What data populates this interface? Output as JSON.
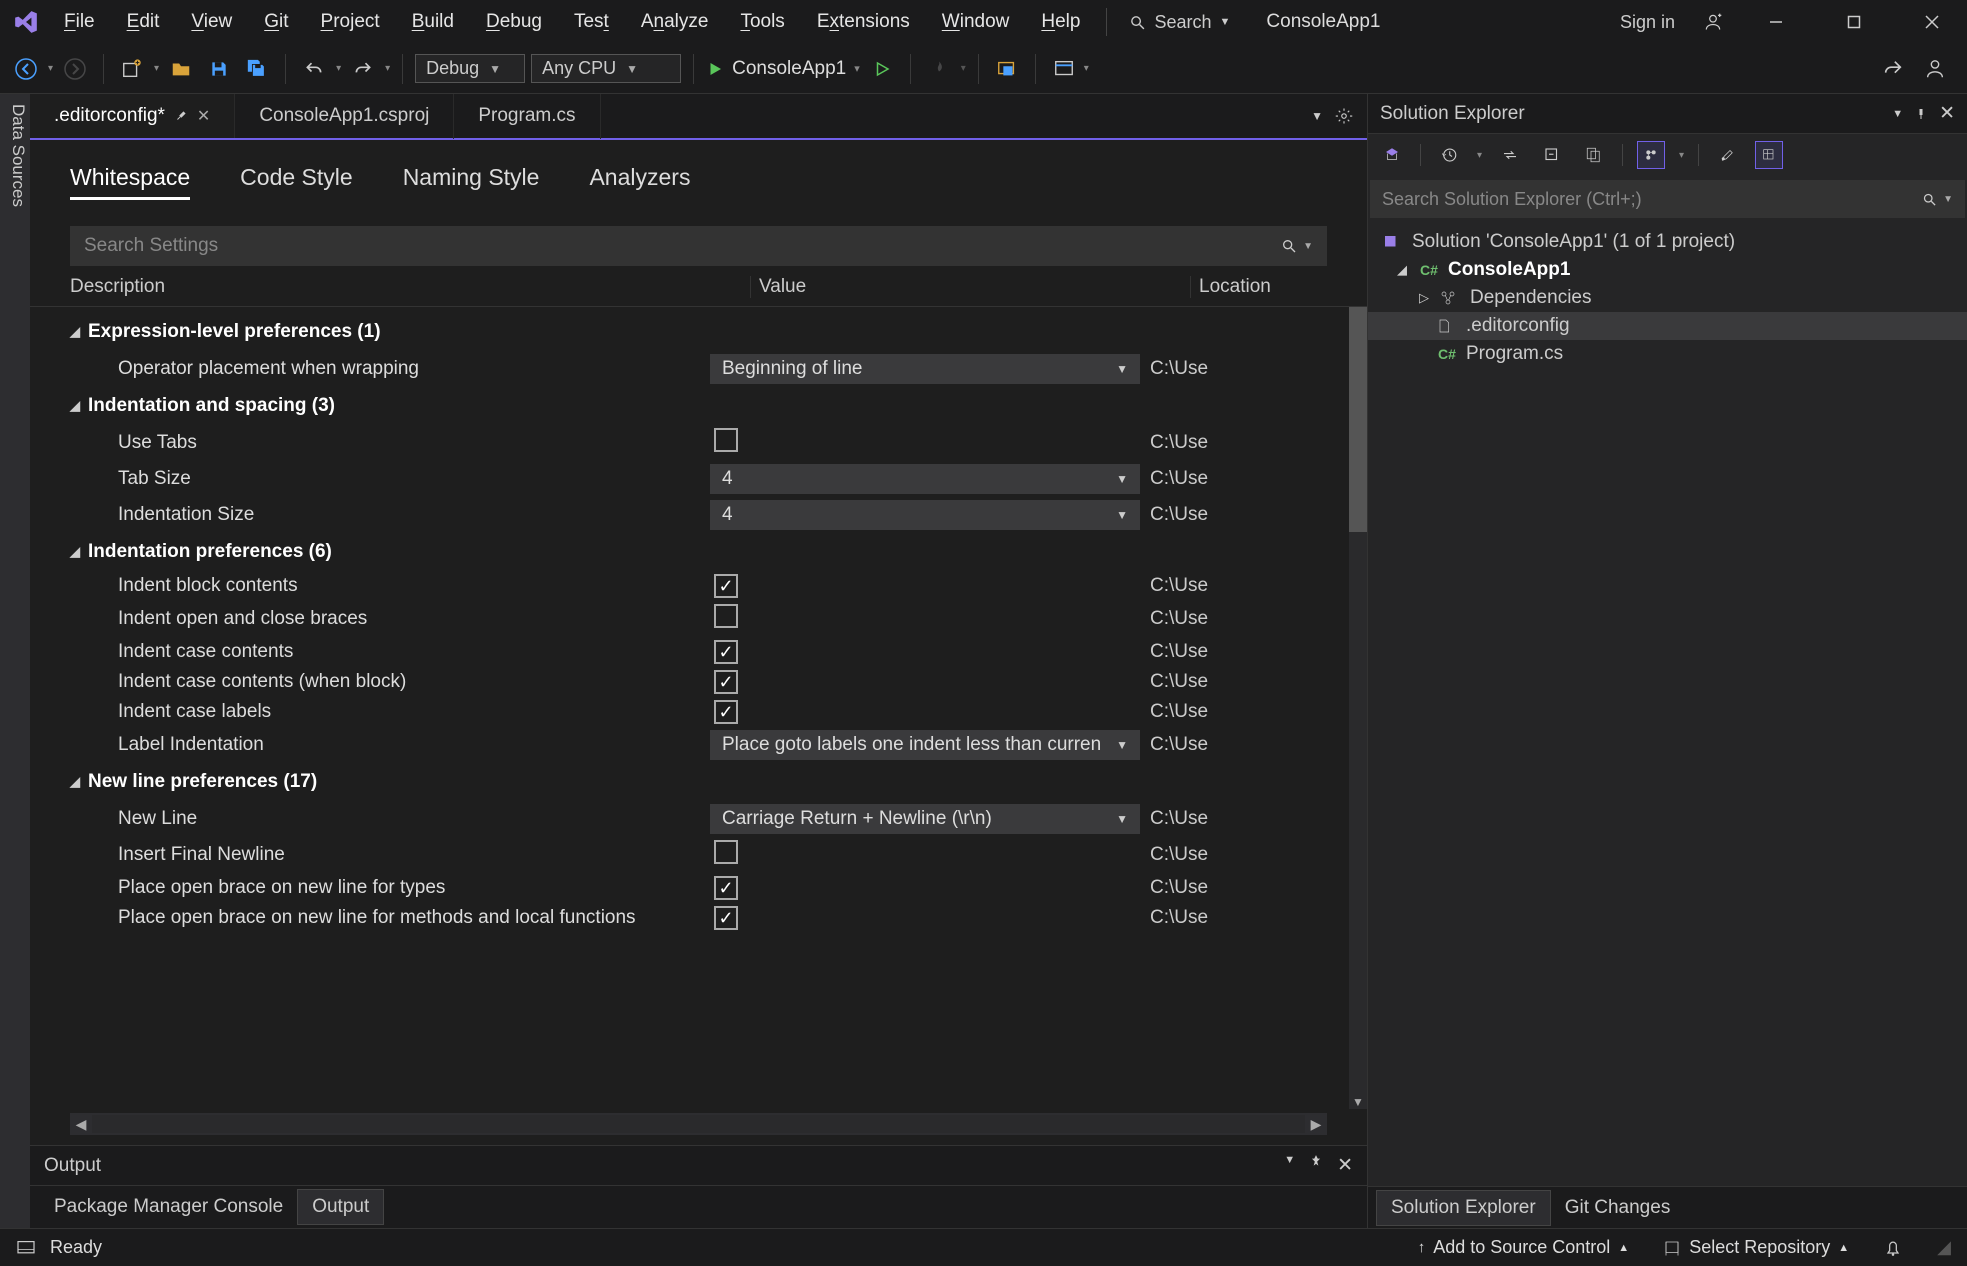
{
  "titlebar": {
    "menu": [
      "File",
      "Edit",
      "View",
      "Git",
      "Project",
      "Build",
      "Debug",
      "Test",
      "Analyze",
      "Tools",
      "Extensions",
      "Window",
      "Help"
    ],
    "menu_underline_html": [
      "<u>F</u>ile",
      "<u>E</u>dit",
      "<u>V</u>iew",
      "<u>G</u>it",
      "<u>P</u>roject",
      "<u>B</u>uild",
      "<u>D</u>ebug",
      "Tes<u>t</u>",
      "A<u>n</u>alyze",
      "<u>T</u>ools",
      "E<u>x</u>tensions",
      "<u>W</u>indow",
      "<u>H</u>elp"
    ],
    "search_label": "Search",
    "app_title": "ConsoleApp1",
    "sign_in": "Sign in"
  },
  "toolbar": {
    "config_combo": "Debug",
    "platform_combo": "Any CPU",
    "run_target": "ConsoleApp1"
  },
  "left_rail": {
    "label": "Data Sources"
  },
  "doc_tabs": {
    "items": [
      {
        "label": ".editorconfig*",
        "active": true,
        "pinned": true
      },
      {
        "label": "ConsoleApp1.csproj",
        "active": false
      },
      {
        "label": "Program.cs",
        "active": false
      }
    ]
  },
  "editorconfig": {
    "inner_tabs": [
      "Whitespace",
      "Code Style",
      "Naming Style",
      "Analyzers"
    ],
    "active_inner_tab": "Whitespace",
    "search_placeholder": "Search Settings",
    "columns": {
      "desc": "Description",
      "val": "Value",
      "loc": "Location"
    },
    "loc_trunc": "C:\\Use",
    "groups": [
      {
        "name": "Expression-level preferences",
        "count": 1,
        "rows": [
          {
            "desc": "Operator placement when wrapping",
            "type": "combo",
            "value": "Beginning of line"
          }
        ]
      },
      {
        "name": "Indentation and spacing",
        "count": 3,
        "rows": [
          {
            "desc": "Use Tabs",
            "type": "check",
            "value": false
          },
          {
            "desc": "Tab Size",
            "type": "combo",
            "value": "4"
          },
          {
            "desc": "Indentation Size",
            "type": "combo",
            "value": "4"
          }
        ]
      },
      {
        "name": "Indentation preferences",
        "count": 6,
        "rows": [
          {
            "desc": "Indent block contents",
            "type": "check",
            "value": true
          },
          {
            "desc": "Indent open and close braces",
            "type": "check",
            "value": false
          },
          {
            "desc": "Indent case contents",
            "type": "check",
            "value": true
          },
          {
            "desc": "Indent case contents (when block)",
            "type": "check",
            "value": true
          },
          {
            "desc": "Indent case labels",
            "type": "check",
            "value": true
          },
          {
            "desc": "Label Indentation",
            "type": "combo",
            "value": "Place goto labels one indent less than curren"
          }
        ]
      },
      {
        "name": "New line preferences",
        "count": 17,
        "rows": [
          {
            "desc": "New Line",
            "type": "combo",
            "value": "Carriage Return + Newline (\\r\\n)"
          },
          {
            "desc": "Insert Final Newline",
            "type": "check",
            "value": false
          },
          {
            "desc": "Place open brace on new line for types",
            "type": "check",
            "value": true
          },
          {
            "desc": "Place open brace on new line for methods and local functions",
            "type": "check",
            "value": true
          }
        ]
      }
    ]
  },
  "output": {
    "title": "Output",
    "bottom_tabs": [
      "Package Manager Console",
      "Output"
    ],
    "active_bottom_tab": "Output"
  },
  "solution_explorer": {
    "title": "Solution Explorer",
    "search_placeholder": "Search Solution Explorer (Ctrl+;)",
    "solution_label": "Solution 'ConsoleApp1' (1 of 1 project)",
    "project_label": "ConsoleApp1",
    "dependencies_label": "Dependencies",
    "files": [
      ".editorconfig",
      "Program.cs"
    ],
    "right_tabs": [
      "Solution Explorer",
      "Git Changes"
    ],
    "active_right_tab": "Solution Explorer"
  },
  "statusbar": {
    "ready": "Ready",
    "source_control": "Add to Source Control",
    "repo": "Select Repository"
  }
}
